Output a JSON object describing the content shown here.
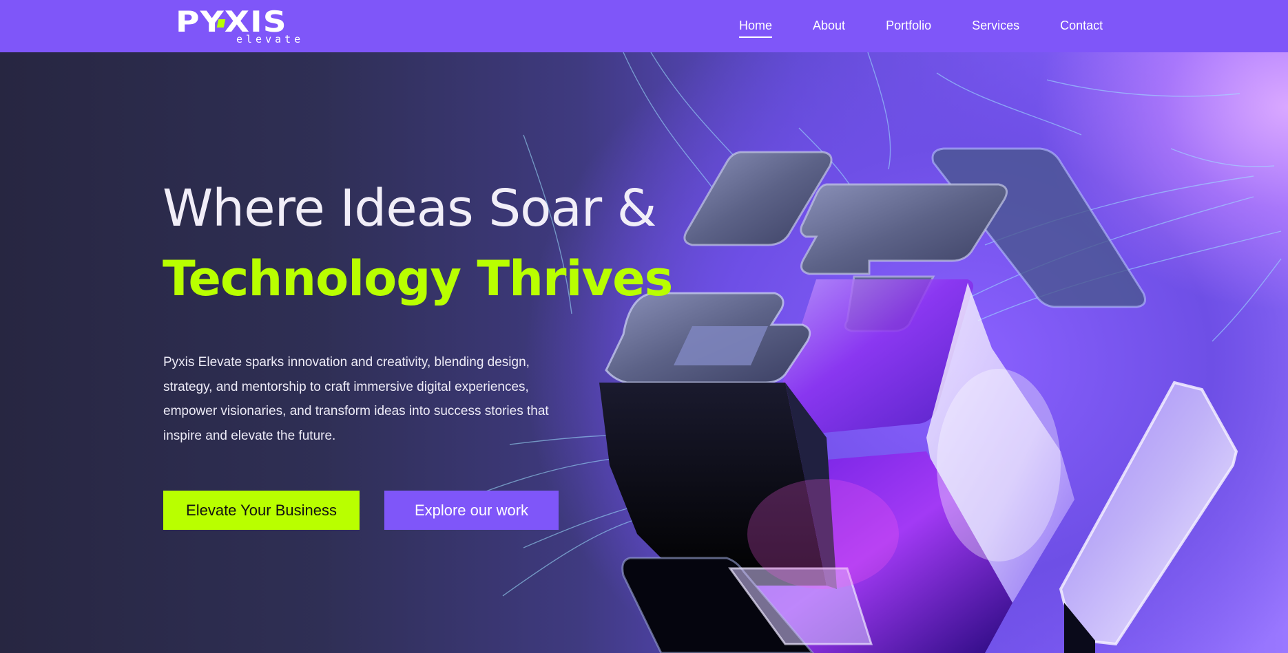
{
  "brand": {
    "logo_word": "PYXIS",
    "logo_sub": "elevate"
  },
  "nav": {
    "items": [
      {
        "label": "Home",
        "active": true
      },
      {
        "label": "About",
        "active": false
      },
      {
        "label": "Portfolio",
        "active": false
      },
      {
        "label": "Services",
        "active": false
      },
      {
        "label": "Contact",
        "active": false
      }
    ]
  },
  "hero": {
    "headline_line1": "Where Ideas Soar &",
    "headline_line2": "Technology Thrives",
    "description": "Pyxis Elevate sparks innovation and creativity, blending design, strategy, and mentorship to craft immersive digital experiences, empower visionaries, and transform ideas into success stories that inspire and elevate the future.",
    "primary_button": "Elevate Your Business",
    "secondary_button": "Explore our work"
  },
  "colors": {
    "brand_purple": "#7f56f9",
    "accent_lime": "#b9ff00",
    "hero_dark": "#272641",
    "text_light": "#f1eef8"
  },
  "icons": {
    "hero_graphic": "glass-cube-illustration"
  }
}
